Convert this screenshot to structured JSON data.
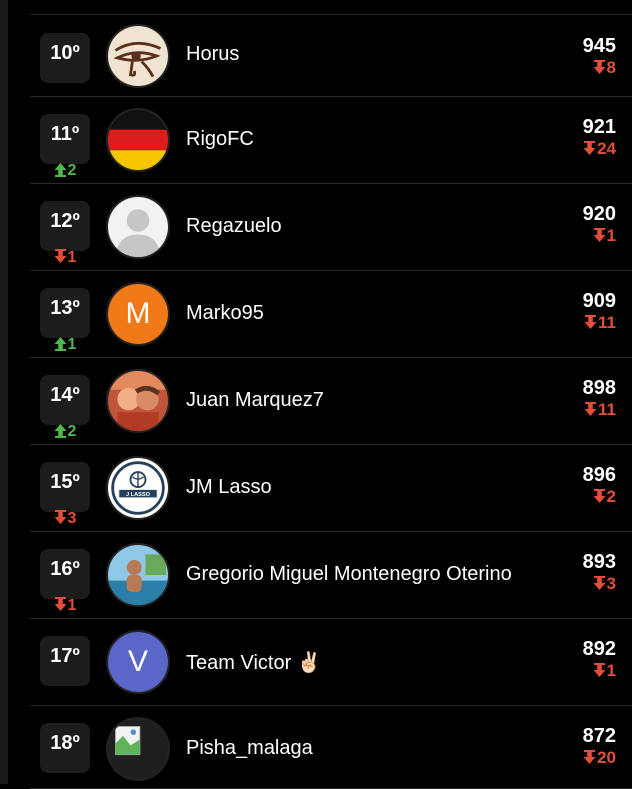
{
  "ranking": [
    {
      "pos": "10º",
      "trend": "",
      "dir": "none",
      "name": "Horus",
      "points": "945",
      "change": "8",
      "avatar": "eye-of-horus"
    },
    {
      "pos": "11º",
      "trend": "2",
      "dir": "up",
      "name": "RigoFC",
      "points": "921",
      "change": "24",
      "avatar": "germany-flag"
    },
    {
      "pos": "12º",
      "trend": "1",
      "dir": "down",
      "name": "Regazuelo",
      "points": "920",
      "change": "1",
      "avatar": "default-user"
    },
    {
      "pos": "13º",
      "trend": "1",
      "dir": "up",
      "name": "Marko95",
      "points": "909",
      "change": "11",
      "avatar": "letter",
      "letter": "M",
      "color": "#f07a17"
    },
    {
      "pos": "14º",
      "trend": "2",
      "dir": "up",
      "name": "Juan Marquez7",
      "points": "898",
      "change": "11",
      "avatar": "photo-couple"
    },
    {
      "pos": "15º",
      "trend": "3",
      "dir": "down",
      "name": "JM Lasso",
      "points": "896",
      "change": "2",
      "avatar": "lasso-logo",
      "logo_text": "J LASSO"
    },
    {
      "pos": "16º",
      "trend": "1",
      "dir": "down",
      "name": "Gregorio Miguel Montenegro Oterino",
      "points": "893",
      "change": "3",
      "avatar": "photo-sea"
    },
    {
      "pos": "17º",
      "trend": "",
      "dir": "none",
      "name": "Team Victor ✌🏻",
      "points": "892",
      "change": "1",
      "avatar": "letter",
      "letter": "V",
      "color": "#5b67c8"
    },
    {
      "pos": "18º",
      "trend": "",
      "dir": "none",
      "name": "Pisha_malaga",
      "points": "872",
      "change": "20",
      "avatar": "broken-image"
    }
  ],
  "colors": {
    "up": "#4fb84a",
    "down": "#e34e3a",
    "background": "#000000"
  }
}
